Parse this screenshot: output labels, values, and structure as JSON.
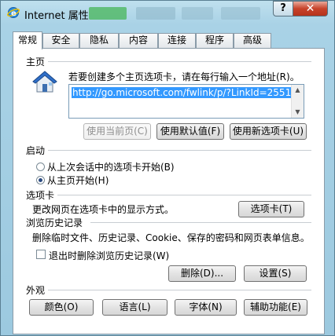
{
  "window": {
    "title": "Internet 属性",
    "help_label": "?",
    "close_label": "✕"
  },
  "tabs": [
    {
      "label": "常规"
    },
    {
      "label": "安全"
    },
    {
      "label": "隐私"
    },
    {
      "label": "内容"
    },
    {
      "label": "连接"
    },
    {
      "label": "程序"
    },
    {
      "label": "高级"
    }
  ],
  "homepage": {
    "heading": "主页",
    "instruction": "若要创建多个主页选项卡，请在每行输入一个地址(R)。",
    "url": "http://go.microsoft.com/fwlink/p/?LinkId=2551",
    "use_current": "使用当前页(C)",
    "use_default": "使用默认值(F)",
    "use_new_tab": "使用新选项卡(U)"
  },
  "startup": {
    "heading": "启动",
    "option_last_session": "从上次会话中的选项卡开始(B)",
    "option_homepage": "从主页开始(H)",
    "selected": "option_homepage"
  },
  "tabs_section": {
    "heading": "选项卡",
    "description": "更改网页在选项卡中的显示方式。",
    "button": "选项卡(T)"
  },
  "history": {
    "heading": "浏览历史记录",
    "description": "删除临时文件、历史记录、Cookie、保存的密码和网页表单信息。",
    "delete_on_exit": "退出时删除浏览历史记录(W)",
    "delete_on_exit_checked": false,
    "delete_button": "删除(D)...",
    "settings_button": "设置(S)"
  },
  "appearance": {
    "heading": "外观",
    "colors": "颜色(O)",
    "languages": "语言(L)",
    "fonts": "字体(N)",
    "accessibility": "辅助功能(E)"
  }
}
